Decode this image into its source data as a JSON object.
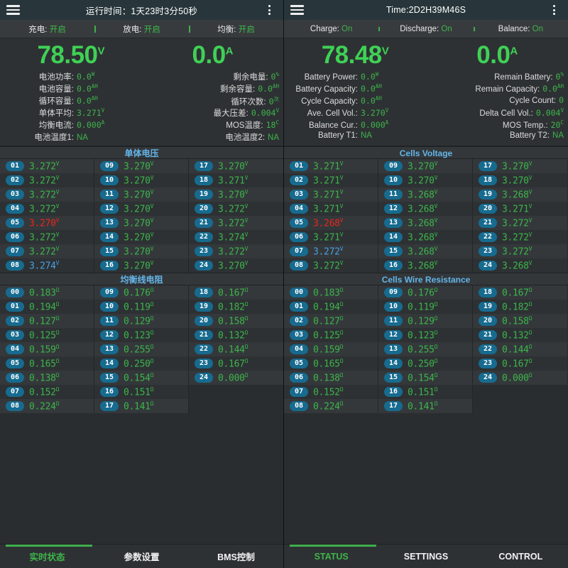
{
  "panels": [
    {
      "id": "cn",
      "appbar": {
        "title": "运行时间：1天23时3分50秒",
        "menu_icon": "hamburger-icon",
        "overflow_icon": "kebab-menu-icon"
      },
      "status": [
        {
          "label": "充电:",
          "value": "开启"
        },
        {
          "label": "放电:",
          "value": "开启"
        },
        {
          "label": "均衡:",
          "value": "开启"
        }
      ],
      "big": [
        {
          "value": "78.50",
          "unit": "V"
        },
        {
          "value": "0.0",
          "unit": "A"
        }
      ],
      "stats_left": [
        {
          "label": "电池功率:",
          "value": "0.0",
          "unit": "W"
        },
        {
          "label": "电池容量:",
          "value": "0.0",
          "unit": "AH"
        },
        {
          "label": "循环容量:",
          "value": "0.0",
          "unit": "AH"
        },
        {
          "label": "单体平均:",
          "value": "3.271",
          "unit": "V"
        },
        {
          "label": "均衡电流:",
          "value": "0.000",
          "unit": "A"
        },
        {
          "label": "电池温度1:",
          "value": "NA",
          "unit": ""
        }
      ],
      "stats_right": [
        {
          "label": "剩余电量:",
          "value": "0",
          "unit": "%"
        },
        {
          "label": "剩余容量:",
          "value": "0.0",
          "unit": "AH"
        },
        {
          "label": "循环次数:",
          "value": "0",
          "unit": "次"
        },
        {
          "label": "最大压差:",
          "value": "0.004",
          "unit": "V"
        },
        {
          "label": "MOS温度:",
          "value": "18",
          "unit": "C"
        },
        {
          "label": "电池温度2:",
          "value": "NA",
          "unit": ""
        }
      ],
      "voltage_header": "单体电压",
      "resistance_header": "均衡线电阻",
      "cells": [
        {
          "id": "01",
          "v": "3.272",
          "u": "V",
          "state": "normal"
        },
        {
          "id": "02",
          "v": "3.272",
          "u": "V",
          "state": "normal"
        },
        {
          "id": "03",
          "v": "3.272",
          "u": "V",
          "state": "normal"
        },
        {
          "id": "04",
          "v": "3.272",
          "u": "V",
          "state": "normal"
        },
        {
          "id": "05",
          "v": "3.270",
          "u": "V",
          "state": "min"
        },
        {
          "id": "06",
          "v": "3.272",
          "u": "V",
          "state": "normal"
        },
        {
          "id": "07",
          "v": "3.272",
          "u": "V",
          "state": "normal"
        },
        {
          "id": "08",
          "v": "3.274",
          "u": "V",
          "state": "max"
        },
        {
          "id": "09",
          "v": "3.270",
          "u": "V",
          "state": "normal"
        },
        {
          "id": "10",
          "v": "3.270",
          "u": "V",
          "state": "normal"
        },
        {
          "id": "11",
          "v": "3.270",
          "u": "V",
          "state": "normal"
        },
        {
          "id": "12",
          "v": "3.270",
          "u": "V",
          "state": "normal"
        },
        {
          "id": "13",
          "v": "3.270",
          "u": "V",
          "state": "normal"
        },
        {
          "id": "14",
          "v": "3.270",
          "u": "V",
          "state": "normal"
        },
        {
          "id": "15",
          "v": "3.270",
          "u": "V",
          "state": "normal"
        },
        {
          "id": "16",
          "v": "3.270",
          "u": "V",
          "state": "normal"
        },
        {
          "id": "17",
          "v": "3.270",
          "u": "V",
          "state": "normal"
        },
        {
          "id": "18",
          "v": "3.271",
          "u": "V",
          "state": "normal"
        },
        {
          "id": "19",
          "v": "3.270",
          "u": "V",
          "state": "normal"
        },
        {
          "id": "20",
          "v": "3.272",
          "u": "V",
          "state": "normal"
        },
        {
          "id": "21",
          "v": "3.272",
          "u": "V",
          "state": "normal"
        },
        {
          "id": "22",
          "v": "3.274",
          "u": "V",
          "state": "normal"
        },
        {
          "id": "23",
          "v": "3.272",
          "u": "V",
          "state": "normal"
        },
        {
          "id": "24",
          "v": "3.270",
          "u": "V",
          "state": "normal"
        }
      ],
      "resistances": [
        {
          "id": "00",
          "v": "0.183",
          "u": "Ω"
        },
        {
          "id": "01",
          "v": "0.194",
          "u": "Ω"
        },
        {
          "id": "02",
          "v": "0.127",
          "u": "Ω"
        },
        {
          "id": "03",
          "v": "0.125",
          "u": "Ω"
        },
        {
          "id": "04",
          "v": "0.159",
          "u": "Ω"
        },
        {
          "id": "05",
          "v": "0.165",
          "u": "Ω"
        },
        {
          "id": "06",
          "v": "0.138",
          "u": "Ω"
        },
        {
          "id": "07",
          "v": "0.152",
          "u": "Ω"
        },
        {
          "id": "08",
          "v": "0.224",
          "u": "Ω"
        },
        {
          "id": "09",
          "v": "0.176",
          "u": "Ω"
        },
        {
          "id": "10",
          "v": "0.119",
          "u": "Ω"
        },
        {
          "id": "11",
          "v": "0.129",
          "u": "Ω"
        },
        {
          "id": "12",
          "v": "0.123",
          "u": "Ω"
        },
        {
          "id": "13",
          "v": "0.255",
          "u": "Ω"
        },
        {
          "id": "14",
          "v": "0.250",
          "u": "Ω"
        },
        {
          "id": "15",
          "v": "0.154",
          "u": "Ω"
        },
        {
          "id": "16",
          "v": "0.151",
          "u": "Ω"
        },
        {
          "id": "17",
          "v": "0.141",
          "u": "Ω"
        },
        {
          "id": "18",
          "v": "0.167",
          "u": "Ω"
        },
        {
          "id": "19",
          "v": "0.182",
          "u": "Ω"
        },
        {
          "id": "20",
          "v": "0.158",
          "u": "Ω"
        },
        {
          "id": "21",
          "v": "0.132",
          "u": "Ω"
        },
        {
          "id": "22",
          "v": "0.144",
          "u": "Ω"
        },
        {
          "id": "23",
          "v": "0.167",
          "u": "Ω"
        },
        {
          "id": "24",
          "v": "0.000",
          "u": "Ω"
        }
      ],
      "tabs": [
        {
          "label": "实时状态",
          "active": true
        },
        {
          "label": "参数设置",
          "active": false
        },
        {
          "label": "BMS控制",
          "active": false
        }
      ]
    },
    {
      "id": "en",
      "appbar": {
        "title": "Time:2D2H39M46S",
        "menu_icon": "hamburger-icon",
        "overflow_icon": "kebab-menu-icon"
      },
      "status": [
        {
          "label": "Charge:",
          "value": "On"
        },
        {
          "label": "Discharge:",
          "value": "On"
        },
        {
          "label": "Balance:",
          "value": "On"
        }
      ],
      "big": [
        {
          "value": "78.48",
          "unit": "V"
        },
        {
          "value": "0.0",
          "unit": "A"
        }
      ],
      "stats_left": [
        {
          "label": "Battery Power:",
          "value": "0.0",
          "unit": "W"
        },
        {
          "label": "Battery Capacity:",
          "value": "0.0",
          "unit": "AH"
        },
        {
          "label": "Cycle Capacity:",
          "value": "0.0",
          "unit": "AH"
        },
        {
          "label": "Ave. Cell Vol.:",
          "value": "3.270",
          "unit": "V"
        },
        {
          "label": "Balance Cur.:",
          "value": "0.000",
          "unit": "A"
        },
        {
          "label": "Battery T1:",
          "value": "NA",
          "unit": ""
        }
      ],
      "stats_right": [
        {
          "label": "Remain Battery:",
          "value": "0",
          "unit": "%"
        },
        {
          "label": "Remain Capacity:",
          "value": "0.0",
          "unit": "AH"
        },
        {
          "label": "Cycle Count:",
          "value": "0",
          "unit": ""
        },
        {
          "label": "Delta Cell Vol.:",
          "value": "0.004",
          "unit": "V"
        },
        {
          "label": "MOS Temp.:",
          "value": "20",
          "unit": "C"
        },
        {
          "label": "Battery T2:",
          "value": "NA",
          "unit": ""
        }
      ],
      "voltage_header": "Cells Voltage",
      "resistance_header": "Cells Wire Resistance",
      "cells": [
        {
          "id": "01",
          "v": "3.271",
          "u": "V",
          "state": "normal"
        },
        {
          "id": "02",
          "v": "3.271",
          "u": "V",
          "state": "normal"
        },
        {
          "id": "03",
          "v": "3.271",
          "u": "V",
          "state": "normal"
        },
        {
          "id": "04",
          "v": "3.271",
          "u": "V",
          "state": "normal"
        },
        {
          "id": "05",
          "v": "3.268",
          "u": "V",
          "state": "min"
        },
        {
          "id": "06",
          "v": "3.271",
          "u": "V",
          "state": "normal"
        },
        {
          "id": "07",
          "v": "3.272",
          "u": "V",
          "state": "max"
        },
        {
          "id": "08",
          "v": "3.272",
          "u": "V",
          "state": "normal"
        },
        {
          "id": "09",
          "v": "3.270",
          "u": "V",
          "state": "normal"
        },
        {
          "id": "10",
          "v": "3.270",
          "u": "V",
          "state": "normal"
        },
        {
          "id": "11",
          "v": "3.268",
          "u": "V",
          "state": "normal"
        },
        {
          "id": "12",
          "v": "3.268",
          "u": "V",
          "state": "normal"
        },
        {
          "id": "13",
          "v": "3.268",
          "u": "V",
          "state": "normal"
        },
        {
          "id": "14",
          "v": "3.268",
          "u": "V",
          "state": "normal"
        },
        {
          "id": "15",
          "v": "3.268",
          "u": "V",
          "state": "normal"
        },
        {
          "id": "16",
          "v": "3.268",
          "u": "V",
          "state": "normal"
        },
        {
          "id": "17",
          "v": "3.270",
          "u": "V",
          "state": "normal"
        },
        {
          "id": "18",
          "v": "3.270",
          "u": "V",
          "state": "normal"
        },
        {
          "id": "19",
          "v": "3.268",
          "u": "V",
          "state": "normal"
        },
        {
          "id": "20",
          "v": "3.271",
          "u": "V",
          "state": "normal"
        },
        {
          "id": "21",
          "v": "3.272",
          "u": "V",
          "state": "normal"
        },
        {
          "id": "22",
          "v": "3.272",
          "u": "V",
          "state": "normal"
        },
        {
          "id": "23",
          "v": "3.272",
          "u": "V",
          "state": "normal"
        },
        {
          "id": "24",
          "v": "3.268",
          "u": "V",
          "state": "normal"
        }
      ],
      "resistances": [
        {
          "id": "00",
          "v": "0.183",
          "u": "Ω"
        },
        {
          "id": "01",
          "v": "0.194",
          "u": "Ω"
        },
        {
          "id": "02",
          "v": "0.127",
          "u": "Ω"
        },
        {
          "id": "03",
          "v": "0.125",
          "u": "Ω"
        },
        {
          "id": "04",
          "v": "0.159",
          "u": "Ω"
        },
        {
          "id": "05",
          "v": "0.165",
          "u": "Ω"
        },
        {
          "id": "06",
          "v": "0.138",
          "u": "Ω"
        },
        {
          "id": "07",
          "v": "0.152",
          "u": "Ω"
        },
        {
          "id": "08",
          "v": "0.224",
          "u": "Ω"
        },
        {
          "id": "09",
          "v": "0.176",
          "u": "Ω"
        },
        {
          "id": "10",
          "v": "0.119",
          "u": "Ω"
        },
        {
          "id": "11",
          "v": "0.129",
          "u": "Ω"
        },
        {
          "id": "12",
          "v": "0.123",
          "u": "Ω"
        },
        {
          "id": "13",
          "v": "0.255",
          "u": "Ω"
        },
        {
          "id": "14",
          "v": "0.250",
          "u": "Ω"
        },
        {
          "id": "15",
          "v": "0.154",
          "u": "Ω"
        },
        {
          "id": "16",
          "v": "0.151",
          "u": "Ω"
        },
        {
          "id": "17",
          "v": "0.141",
          "u": "Ω"
        },
        {
          "id": "18",
          "v": "0.167",
          "u": "Ω"
        },
        {
          "id": "19",
          "v": "0.182",
          "u": "Ω"
        },
        {
          "id": "20",
          "v": "0.158",
          "u": "Ω"
        },
        {
          "id": "21",
          "v": "0.132",
          "u": "Ω"
        },
        {
          "id": "22",
          "v": "0.144",
          "u": "Ω"
        },
        {
          "id": "23",
          "v": "0.167",
          "u": "Ω"
        },
        {
          "id": "24",
          "v": "0.000",
          "u": "Ω"
        }
      ],
      "tabs": [
        {
          "label": "STATUS",
          "active": true
        },
        {
          "label": "SETTINGS",
          "active": false
        },
        {
          "label": "CONTROL",
          "active": false
        }
      ]
    }
  ],
  "colors": {
    "accent_green": "#3db54a",
    "value_green": "#3fd155",
    "min_red": "#e8271c",
    "max_blue": "#4a9fe0",
    "header_blue": "#64b5e8",
    "badge_teal": "#176b8f"
  }
}
